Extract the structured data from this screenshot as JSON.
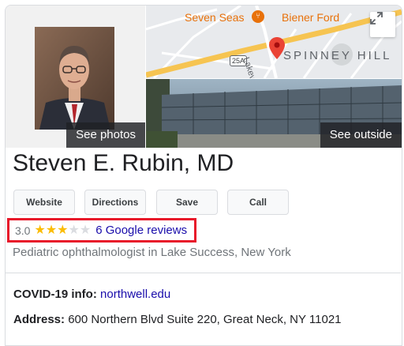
{
  "photos": {
    "caption": "See photos"
  },
  "map": {
    "places": {
      "seven_seas": "Seven Seas",
      "biener_ford": "Biener Ford"
    },
    "road_label": "SPINNEY HILL",
    "route_shield": "25A",
    "street_vertical": "Lakev"
  },
  "street_view": {
    "caption": "See outside"
  },
  "business": {
    "name": "Steven E. Rubin, MD",
    "rating_value": "3.0",
    "rating": 3,
    "rating_max": 5,
    "reviews_label": "6 Google reviews",
    "category": "Pediatric ophthalmologist in Lake Success, New York"
  },
  "actions": {
    "website": "Website",
    "directions": "Directions",
    "save": "Save",
    "call": "Call"
  },
  "info": {
    "covid_label": "COVID-19 info:",
    "covid_link": "northwell.edu",
    "address_label": "Address:",
    "address_value": "600 Northern Blvd Suite 220, Great Neck, NY 11021"
  },
  "colors": {
    "star": "#fbbc04",
    "link": "#1a0dab",
    "highlight_border": "#e8182a",
    "map_pin": "#ea4335"
  }
}
